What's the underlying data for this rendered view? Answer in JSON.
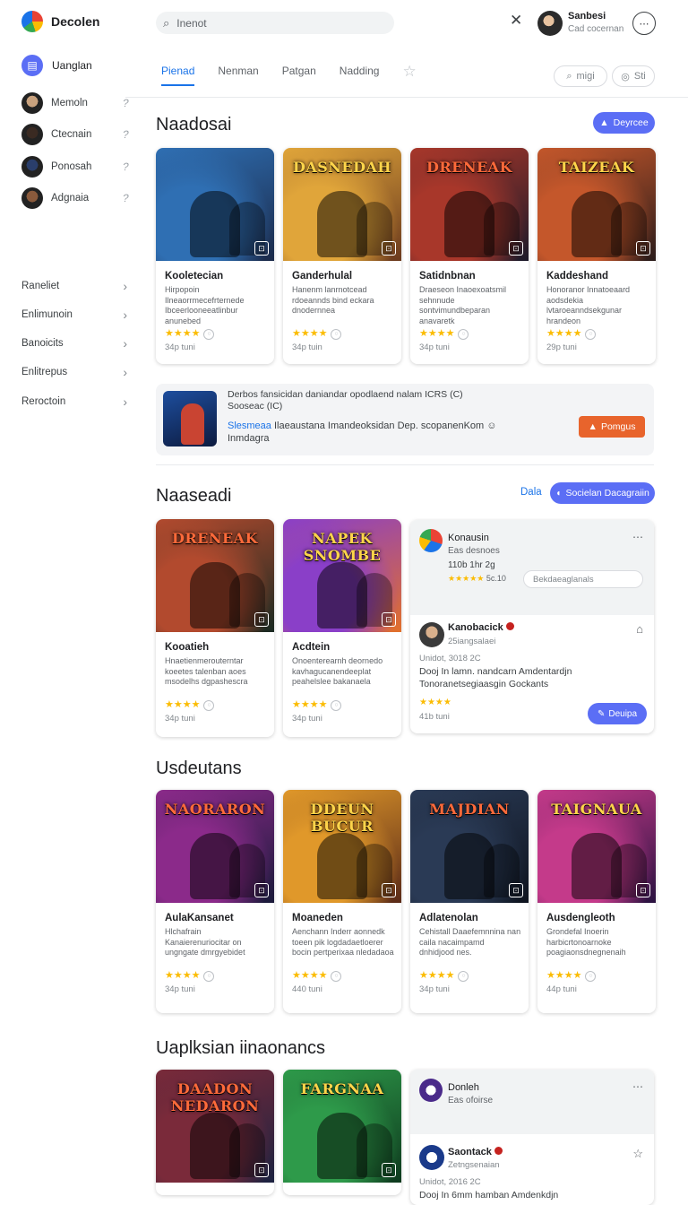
{
  "app": {
    "name": "Decolen"
  },
  "sidebar": {
    "main_item": {
      "label": "Uanglan",
      "icon": "clipboard-icon"
    },
    "people": [
      {
        "name": "Memoln",
        "color": "#c9a27e"
      },
      {
        "name": "Ctecnain",
        "color": "#3a2a22"
      },
      {
        "name": "Ponosah",
        "color": "#2a3e6b"
      },
      {
        "name": "Adgnaia",
        "color": "#8a5a3c"
      }
    ],
    "categories": [
      "Raneliet",
      "Enlimunoin",
      "Banoicits",
      "Enlitrepus",
      "Reroctoin"
    ]
  },
  "header": {
    "search": {
      "placeholder": "Inenot"
    },
    "user": {
      "name": "Sanbesi",
      "sub": "Cad cocernan"
    }
  },
  "tabs": {
    "items": [
      "Pienad",
      "Nenman",
      "Patgan",
      "Nadding"
    ],
    "active": "Pienad",
    "button1": "migi",
    "button2": "Sti"
  },
  "section1": {
    "title": "Naadosai",
    "button": "Deyrcee",
    "cards": [
      {
        "thumb_title": "",
        "c1": "#2f6fb3",
        "c2": "#1b2a4a",
        "name": "Kooletecian",
        "desc": "Hirpopoin Ilneaorrmecefrternede Ibceerlooneeatlinbur anunebed",
        "rating": "★★★★",
        "size": "34p tuni"
      },
      {
        "thumb_title": "DASNEDAH",
        "c1": "#e0a53a",
        "c2": "#6b3a1e",
        "name": "Ganderhulal",
        "desc": "Hanenm lanrnotcead rdoeannds bind eckara dnodernnea",
        "rating": "★★★★",
        "size": "34p tuin"
      },
      {
        "thumb_title": "DRENEAK",
        "c1": "#a8372a",
        "c2": "#1c1a2a",
        "name": "Satidnbnan",
        "desc": "Draeseon Inaoexoatsmil sehnnude sontvimundbeparan anavaretk",
        "rating": "★★★★",
        "size": "34p tuni"
      },
      {
        "thumb_title": "TAIZEAK",
        "c1": "#c4572b",
        "c2": "#2a1b1a",
        "name": "Kaddeshand",
        "desc": "Honoranor Innatoeaard aodsdekia lvtaroeanndsekgunar hrandeon",
        "rating": "★★★★",
        "size": "29p tuni"
      }
    ]
  },
  "promo": {
    "title": "Derbos fansicidan daniandar opodlaend nalam ICRS (C) Sooseac (IC)",
    "link": "Slesmeaa",
    "text": "Ilaeaustana Imandeoksidan Dep. scopanenKom",
    "text2": "Inmdagra",
    "button": "Pomgus"
  },
  "section2": {
    "title": "Naaseadi",
    "link": "Dala",
    "button": "Socielan Dacagraiin",
    "cards": [
      {
        "thumb_title": "DRENEAK",
        "c1": "#b24a2e",
        "c2": "#1a2a22",
        "name": "Kooatieh",
        "desc": "Hnaetienmerouterntar koeetes talenban aoes msodelhs dgpashescra",
        "rating": "★★★★",
        "size": "34p tuni"
      },
      {
        "thumb_title": "NAPEK SNOMBE",
        "c1": "#8a3fc8",
        "c2": "#e2702a",
        "name": "Acdtein",
        "desc": "Onoenterearnh deornedo kavhagucanendeeplat peahelslee bakanaela",
        "rating": "★★★★",
        "size": "34p tuni"
      }
    ],
    "info": {
      "name": "Konausin",
      "sub": "Eas desnoes",
      "line": "110b 1hr 2g",
      "rating": "★★★★★",
      "rating_text": "5c.10",
      "field": "Bekdaeaglanals",
      "review": {
        "name": "Kanobacick",
        "sub": "25iangsalaei",
        "date": "Unidot, 3018 2C",
        "text": "Dooj In lamn. nandcarn Amdentardjn Tonoranetsegiaasgin Gockants",
        "rating": "★★★★",
        "size": "41b tuni",
        "button": "Deuipa"
      }
    }
  },
  "section3": {
    "title": "Usdeutans",
    "cards": [
      {
        "thumb_title": "NAORARON",
        "c1": "#8b2a8a",
        "c2": "#1a1a3a",
        "name": "AulaKansanet",
        "desc": "Hlchafrain Kanaierenuriocitar on ungngate dmrgyebidet",
        "rating": "★★★★",
        "size": "34p tuni"
      },
      {
        "thumb_title": "DDEUN BUCUR",
        "c1": "#e0982a",
        "c2": "#5a2a18",
        "name": "Moaneden",
        "desc": "Aenchann Inderr aonnedk toeen pik logdadaetloerer bocin pertperixaa nledadaoa",
        "rating": "★★★★",
        "size": "440 tuni"
      },
      {
        "thumb_title": "MAJDIAN",
        "c1": "#2a3a55",
        "c2": "#0e141f",
        "name": "Adlatenolan",
        "desc": "Cehistall Daaefemnnina nan caila nacaimpamd dnhidjood nes.",
        "rating": "★★★★",
        "size": "34p tuni"
      },
      {
        "thumb_title": "TAIGNAUA",
        "c1": "#c43a8a",
        "c2": "#2a1240",
        "name": "Ausdengleoth",
        "desc": "Grondefal Inoerin harbicrtonoarnoke poagiaonsdnegnenaih",
        "rating": "★★★★",
        "size": "44p tuni"
      }
    ]
  },
  "section4": {
    "title": "Uaplksian iinaonancs",
    "cards": [
      {
        "thumb_title": "DAADON NEDARON",
        "c1": "#7a2a3a",
        "c2": "#1c2240",
        "name": "",
        "desc": "",
        "rating": "",
        "size": ""
      },
      {
        "thumb_title": "FARGNAA",
        "c1": "#2e9a4a",
        "c2": "#0e3a1e",
        "name": "",
        "desc": "",
        "rating": "",
        "size": ""
      }
    ],
    "info": {
      "name": "Donleh",
      "sub": "Eas ofoirse",
      "review": {
        "name": "Saontack",
        "sub": "Zetngsenaian",
        "date": "Unidot, 2016 2C",
        "text": "Dooj In 6mm hamban Amdenkdjn"
      }
    }
  }
}
